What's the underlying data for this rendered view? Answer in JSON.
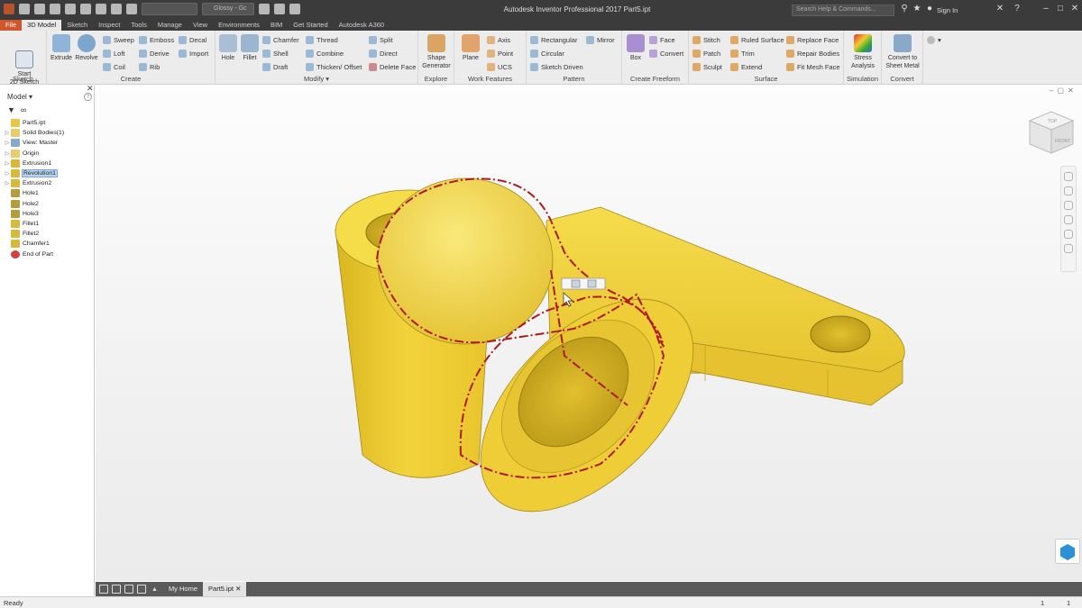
{
  "titlebar": {
    "app_title": "Autodesk Inventor Professional 2017   Part5.ipt",
    "appearance": "Glossy - Gc",
    "search_placeholder": "Search Help & Commands...",
    "sign_in": "Sign In"
  },
  "menu": {
    "tabs": [
      "File",
      "3D Model",
      "Sketch",
      "Inspect",
      "Tools",
      "Manage",
      "View",
      "Environments",
      "BIM",
      "Get Started",
      "Autodesk A360"
    ],
    "active": "3D Model"
  },
  "ribbon": {
    "sketch": {
      "label": "Sketch",
      "start_sketch": "Start\n2D Sketch"
    },
    "create": {
      "label": "Create",
      "extrude": "Extrude",
      "revolve": "Revolve",
      "sweep": "Sweep",
      "emboss": "Emboss",
      "decal": "Decal",
      "loft": "Loft",
      "derive": "Derive",
      "import": "Import",
      "coil": "Coil",
      "rib": "Rib"
    },
    "modify": {
      "label": "Modify ▾",
      "hole": "Hole",
      "fillet": "Fillet",
      "chamfer": "Chamfer",
      "thread": "Thread",
      "split": "Split",
      "shell": "Shell",
      "combine": "Combine",
      "direct": "Direct",
      "draft": "Draft",
      "thicken": "Thicken/ Offset",
      "delete_face": "Delete Face"
    },
    "explore": {
      "label": "Explore",
      "shape_generator": "Shape\nGenerator"
    },
    "work_features": {
      "label": "Work Features",
      "plane": "Plane",
      "axis": "Axis",
      "point": "Point",
      "ucs": "UCS"
    },
    "pattern": {
      "label": "Pattern",
      "rectangular": "Rectangular",
      "mirror": "Mirror",
      "circular": "Circular",
      "sketch_driven": "Sketch Driven"
    },
    "freeform": {
      "label": "Create Freeform",
      "box": "Box",
      "face": "Face",
      "convert": "Convert"
    },
    "surface": {
      "label": "Surface",
      "stitch": "Stitch",
      "ruled_surface": "Ruled Surface",
      "replace_face": "Replace Face",
      "patch": "Patch",
      "trim": "Trim",
      "repair_bodies": "Repair Bodies",
      "sculpt": "Sculpt",
      "extend": "Extend",
      "fit_mesh_face": "Fit Mesh Face"
    },
    "simulation": {
      "label": "Simulation",
      "stress_analysis": "Stress\nAnalysis"
    },
    "convert": {
      "label": "Convert",
      "convert_sheet_metal": "Convert to\nSheet Metal"
    }
  },
  "browser": {
    "title": "Model ▾",
    "items": [
      {
        "label": "Part5.ipt",
        "expander": "",
        "icon": "part-icon"
      },
      {
        "label": "Solid Bodies(1)",
        "expander": "▷",
        "icon": "folder-icon"
      },
      {
        "label": "View: Master",
        "expander": "▷",
        "icon": "view-icon"
      },
      {
        "label": "Origin",
        "expander": "▷",
        "icon": "folder-icon"
      },
      {
        "label": "Extrusion1",
        "expander": "▷",
        "icon": "extrude-icon"
      },
      {
        "label": "Revolution1",
        "expander": "▷",
        "icon": "revolve-icon"
      },
      {
        "label": "Extrusion2",
        "expander": "▷",
        "icon": "extrude-icon"
      },
      {
        "label": "Hole1",
        "expander": "",
        "icon": "hole-icon"
      },
      {
        "label": "Hole2",
        "expander": "",
        "icon": "hole-icon"
      },
      {
        "label": "Hole3",
        "expander": "",
        "icon": "hole-icon"
      },
      {
        "label": "Fillet1",
        "expander": "",
        "icon": "fillet-icon"
      },
      {
        "label": "Fillet2",
        "expander": "",
        "icon": "fillet-icon"
      },
      {
        "label": "Chamfer1",
        "expander": "",
        "icon": "chamfer-icon"
      },
      {
        "label": "End of Part",
        "expander": "",
        "icon": "end-of-part-icon"
      }
    ],
    "selected": "Revolution1"
  },
  "viewcube": {
    "top": "TOP",
    "front": "FRONT"
  },
  "doc_tabs": {
    "home": "My Home",
    "part": "Part5.ipt"
  },
  "status": {
    "text": "Ready",
    "n1": "1",
    "n2": "1"
  },
  "colors": {
    "part_yellow": "#f3d33b",
    "selection_red": "#b01818",
    "file_tab": "#d0562b",
    "title_bar": "#3b3b3b",
    "ribbon_bg": "#ececec"
  }
}
